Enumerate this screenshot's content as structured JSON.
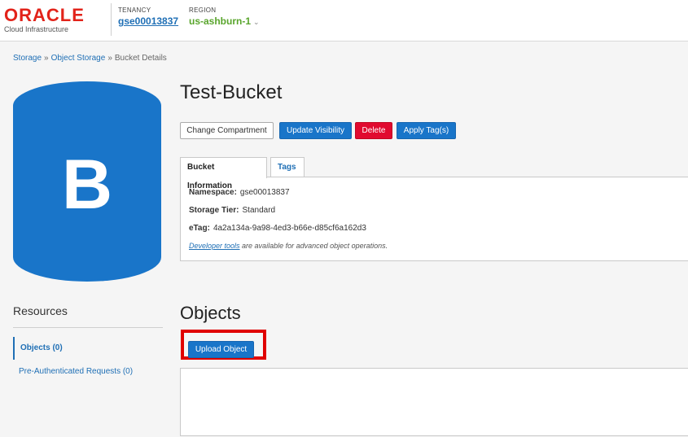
{
  "header": {
    "logo_text": "ORACLE",
    "logo_sub": "Cloud Infrastructure",
    "tenancy_label": "TENANCY",
    "tenancy_value": "gse00013837",
    "region_label": "REGION",
    "region_value": "us-ashburn-1",
    "region_icon": "chevron-down-icon"
  },
  "breadcrumb": {
    "items": [
      "Storage",
      "Object Storage",
      "Bucket Details"
    ],
    "separator": "»"
  },
  "bucket": {
    "letter": "B",
    "title": "Test-Bucket",
    "icon_color": "#1975c9"
  },
  "actions": {
    "change_compartment": "Change Compartment",
    "update_visibility": "Update Visibility",
    "delete": "Delete",
    "apply_tags": "Apply Tag(s)"
  },
  "tabs": {
    "bucket_information": "Bucket Information",
    "tags": "Tags"
  },
  "info": {
    "namespace_label": "Namespace:",
    "namespace_value": "gse00013837",
    "storage_tier_label": "Storage Tier:",
    "storage_tier_value": "Standard",
    "etag_label": "eTag:",
    "etag_value": "4a2a134a-9a98-4ed3-b66e-d85cf6a162d3",
    "dev_tools_link": "Developer tools",
    "dev_tools_text": " are available for advanced object operations."
  },
  "resources": {
    "title": "Resources",
    "items": [
      "Objects (0)",
      "Pre-Authenticated Requests (0)"
    ]
  },
  "objects": {
    "title": "Objects",
    "upload_button": "Upload Object"
  },
  "colors": {
    "primary": "#1975c9",
    "danger": "#e10a2f",
    "region": "#59a52c",
    "highlight": "#e00000",
    "oracle_red": "#e2231a"
  }
}
